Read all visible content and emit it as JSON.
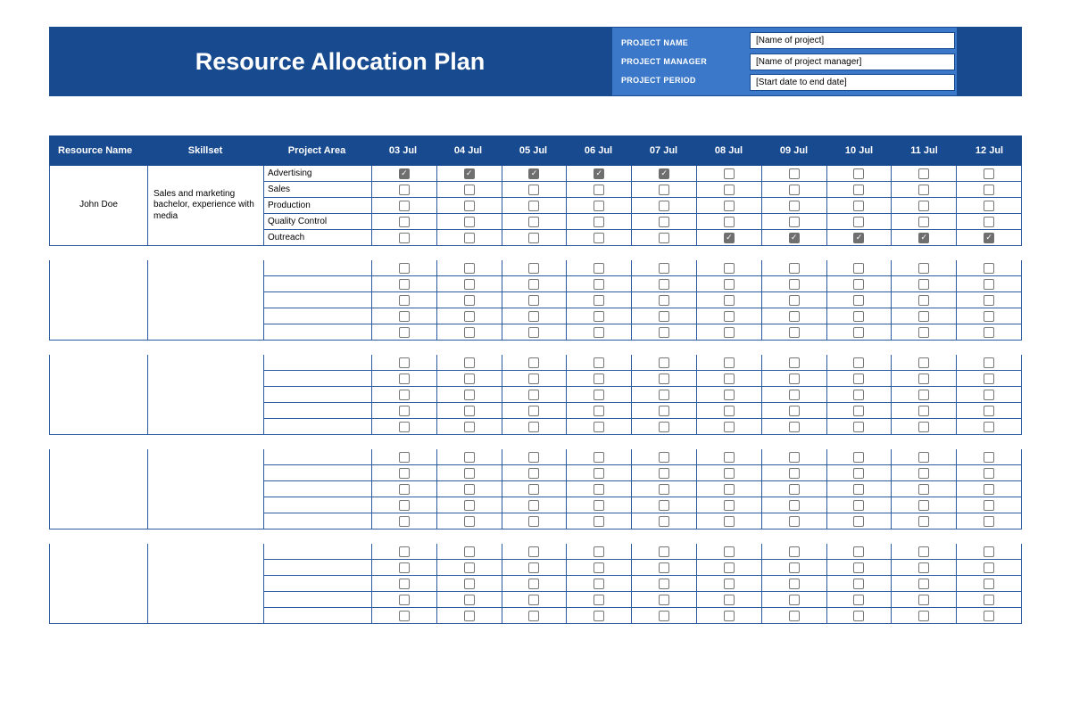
{
  "header": {
    "title": "Resource Allocation Plan",
    "meta_labels": {
      "project_name": "PROJECT NAME",
      "project_manager": "PROJECT MANAGER",
      "project_period": "PROJECT PERIOD"
    },
    "meta_values": {
      "project_name": "[Name of project]",
      "project_manager": "[Name of project manager]",
      "project_period": "[Start date to end date]"
    }
  },
  "columns": {
    "resource_name": "Resource Name",
    "skillset": "Skillset",
    "project_area": "Project Area",
    "dates": [
      "03 Jul",
      "04 Jul",
      "05 Jul",
      "06 Jul",
      "07 Jul",
      "08 Jul",
      "09 Jul",
      "10 Jul",
      "11 Jul",
      "12 Jul"
    ]
  },
  "resources": [
    {
      "name": "John Doe",
      "skillset": "Sales and marketing bachelor, experience with media",
      "tasks": [
        {
          "area": "Advertising",
          "days": [
            true,
            true,
            true,
            true,
            true,
            false,
            false,
            false,
            false,
            false
          ]
        },
        {
          "area": "Sales",
          "days": [
            false,
            false,
            false,
            false,
            false,
            false,
            false,
            false,
            false,
            false
          ]
        },
        {
          "area": "Production",
          "days": [
            false,
            false,
            false,
            false,
            false,
            false,
            false,
            false,
            false,
            false
          ]
        },
        {
          "area": "Quality Control",
          "days": [
            false,
            false,
            false,
            false,
            false,
            false,
            false,
            false,
            false,
            false
          ]
        },
        {
          "area": "Outreach",
          "days": [
            false,
            false,
            false,
            false,
            false,
            true,
            true,
            true,
            true,
            true
          ]
        }
      ]
    },
    {
      "name": "",
      "skillset": "",
      "tasks": [
        {
          "area": "",
          "days": [
            false,
            false,
            false,
            false,
            false,
            false,
            false,
            false,
            false,
            false
          ]
        },
        {
          "area": "",
          "days": [
            false,
            false,
            false,
            false,
            false,
            false,
            false,
            false,
            false,
            false
          ]
        },
        {
          "area": "",
          "days": [
            false,
            false,
            false,
            false,
            false,
            false,
            false,
            false,
            false,
            false
          ]
        },
        {
          "area": "",
          "days": [
            false,
            false,
            false,
            false,
            false,
            false,
            false,
            false,
            false,
            false
          ]
        },
        {
          "area": "",
          "days": [
            false,
            false,
            false,
            false,
            false,
            false,
            false,
            false,
            false,
            false
          ]
        }
      ]
    },
    {
      "name": "",
      "skillset": "",
      "tasks": [
        {
          "area": "",
          "days": [
            false,
            false,
            false,
            false,
            false,
            false,
            false,
            false,
            false,
            false
          ]
        },
        {
          "area": "",
          "days": [
            false,
            false,
            false,
            false,
            false,
            false,
            false,
            false,
            false,
            false
          ]
        },
        {
          "area": "",
          "days": [
            false,
            false,
            false,
            false,
            false,
            false,
            false,
            false,
            false,
            false
          ]
        },
        {
          "area": "",
          "days": [
            false,
            false,
            false,
            false,
            false,
            false,
            false,
            false,
            false,
            false
          ]
        },
        {
          "area": "",
          "days": [
            false,
            false,
            false,
            false,
            false,
            false,
            false,
            false,
            false,
            false
          ]
        }
      ]
    },
    {
      "name": "",
      "skillset": "",
      "tasks": [
        {
          "area": "",
          "days": [
            false,
            false,
            false,
            false,
            false,
            false,
            false,
            false,
            false,
            false
          ]
        },
        {
          "area": "",
          "days": [
            false,
            false,
            false,
            false,
            false,
            false,
            false,
            false,
            false,
            false
          ]
        },
        {
          "area": "",
          "days": [
            false,
            false,
            false,
            false,
            false,
            false,
            false,
            false,
            false,
            false
          ]
        },
        {
          "area": "",
          "days": [
            false,
            false,
            false,
            false,
            false,
            false,
            false,
            false,
            false,
            false
          ]
        },
        {
          "area": "",
          "days": [
            false,
            false,
            false,
            false,
            false,
            false,
            false,
            false,
            false,
            false
          ]
        }
      ]
    },
    {
      "name": "",
      "skillset": "",
      "tasks": [
        {
          "area": "",
          "days": [
            false,
            false,
            false,
            false,
            false,
            false,
            false,
            false,
            false,
            false
          ]
        },
        {
          "area": "",
          "days": [
            false,
            false,
            false,
            false,
            false,
            false,
            false,
            false,
            false,
            false
          ]
        },
        {
          "area": "",
          "days": [
            false,
            false,
            false,
            false,
            false,
            false,
            false,
            false,
            false,
            false
          ]
        },
        {
          "area": "",
          "days": [
            false,
            false,
            false,
            false,
            false,
            false,
            false,
            false,
            false,
            false
          ]
        },
        {
          "area": "",
          "days": [
            false,
            false,
            false,
            false,
            false,
            false,
            false,
            false,
            false,
            false
          ]
        }
      ]
    }
  ]
}
